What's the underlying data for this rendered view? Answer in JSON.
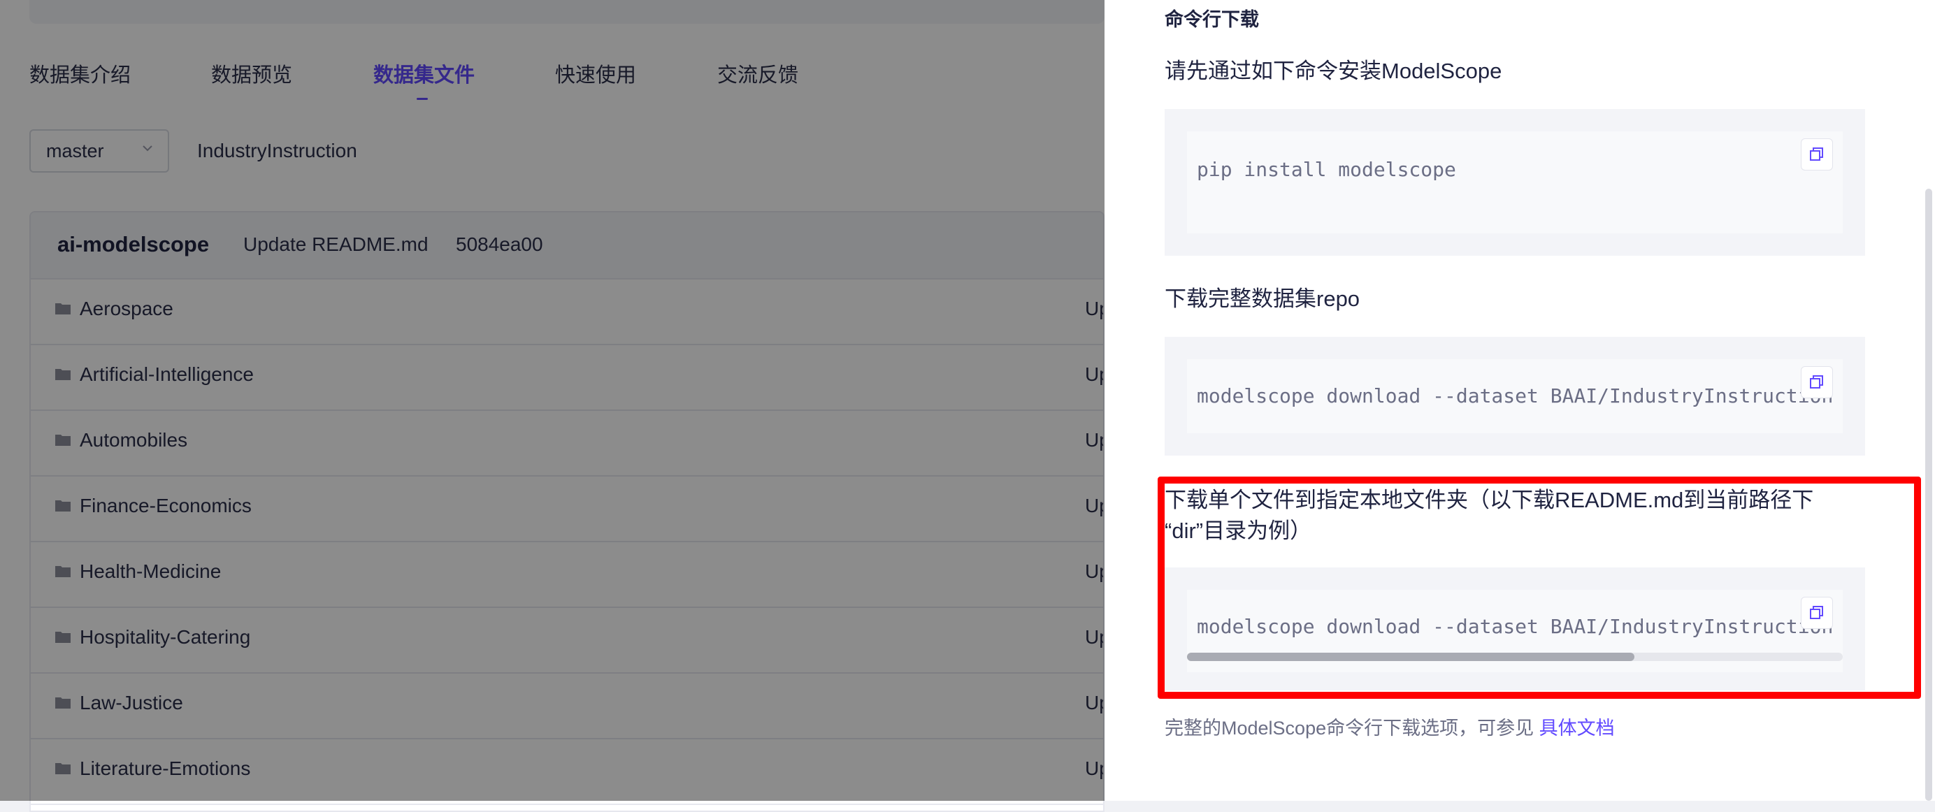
{
  "tabs": [
    "数据集介绍",
    "数据预览",
    "数据集文件",
    "快速使用",
    "交流反馈"
  ],
  "branch": {
    "selected": "master"
  },
  "repo_name": "IndustryInstruction",
  "commit": {
    "author": "ai-modelscope",
    "message": "Update README.md",
    "hash": "5084ea00"
  },
  "files": [
    {
      "name": "Aerospace",
      "status": "Up"
    },
    {
      "name": "Artificial-Intelligence",
      "status": "Up"
    },
    {
      "name": "Automobiles",
      "status": "Up"
    },
    {
      "name": "Finance-Economics",
      "status": "Up"
    },
    {
      "name": "Health-Medicine",
      "status": "Up"
    },
    {
      "name": "Hospitality-Catering",
      "status": "Up"
    },
    {
      "name": "Law-Justice",
      "status": "Up"
    },
    {
      "name": "Literature-Emotions",
      "status": "Up"
    }
  ],
  "drawer": {
    "section_title": "命令行下载",
    "step1": {
      "title": "请先通过如下命令安装ModelScope",
      "code": "pip install modelscope"
    },
    "step2": {
      "title": "下载完整数据集repo",
      "code": "modelscope download --dataset BAAI/IndustryInstruction"
    },
    "step3": {
      "title_line1": "下载单个文件到指定本地文件夹（以下载README.md到当前路径下",
      "title_line2": "“dir”目录为例）",
      "code": "modelscope download --dataset BAAI/IndustryInstruction README.md --local_dir ./dir"
    },
    "footnote": {
      "text": "完整的ModelScope命令行下载选项，可参见",
      "link": "具体文档"
    }
  },
  "colors": {
    "accent": "#624aff",
    "highlight": "#ff0000"
  }
}
